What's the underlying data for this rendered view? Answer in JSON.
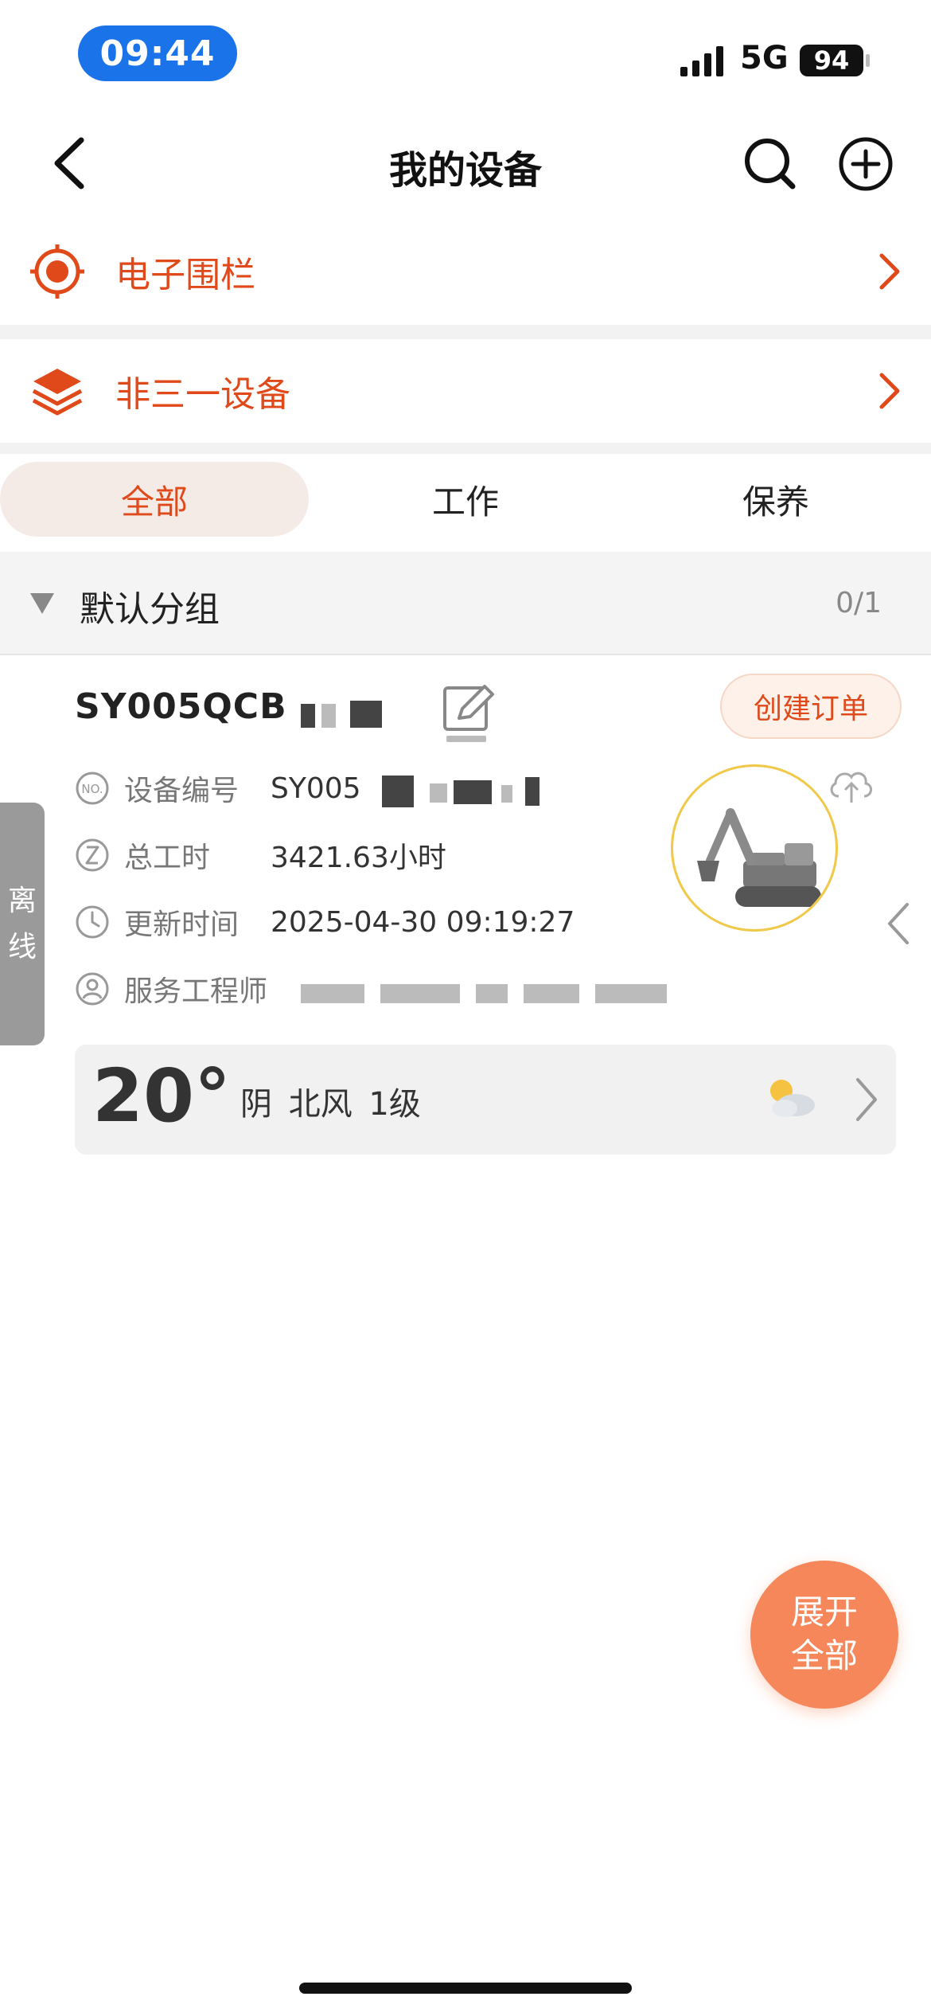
{
  "status_bar": {
    "time": "09:44",
    "network": "5G",
    "battery": "94"
  },
  "nav": {
    "title": "我的设备"
  },
  "menu": [
    {
      "label": "电子围栏",
      "icon": "target-icon"
    },
    {
      "label": "非三一设备",
      "icon": "layers-icon"
    }
  ],
  "tabs": [
    {
      "label": "全部",
      "active": true
    },
    {
      "label": "工作",
      "active": false
    },
    {
      "label": "保养",
      "active": false
    }
  ],
  "group": {
    "title": "默认分组",
    "count": "0/1"
  },
  "device": {
    "name": "SY005QCB",
    "order_button": "创建订单",
    "status_tab": [
      "离",
      "线"
    ],
    "rows": [
      {
        "label": "设备编号",
        "value": "SY005",
        "icon": "number-icon"
      },
      {
        "label": "总工时",
        "value": "3421.63小时",
        "icon": "hourglass-icon"
      },
      {
        "label": "更新时间",
        "value": "2025-04-30 09:19:27",
        "icon": "clock-icon"
      },
      {
        "label": "服务工程师",
        "value": "",
        "icon": "person-icon"
      }
    ],
    "machine_icon": "excavator-icon"
  },
  "weather": {
    "temp": "20°",
    "desc": "阴 北风 1级",
    "icon": "partly-cloudy-icon"
  },
  "fab": {
    "line1": "展开",
    "line2": "全部"
  },
  "colors": {
    "accent": "#e04a1b",
    "fab": "#f5875a",
    "ring": "#f0c94a",
    "time_pill": "#1a73e8"
  }
}
